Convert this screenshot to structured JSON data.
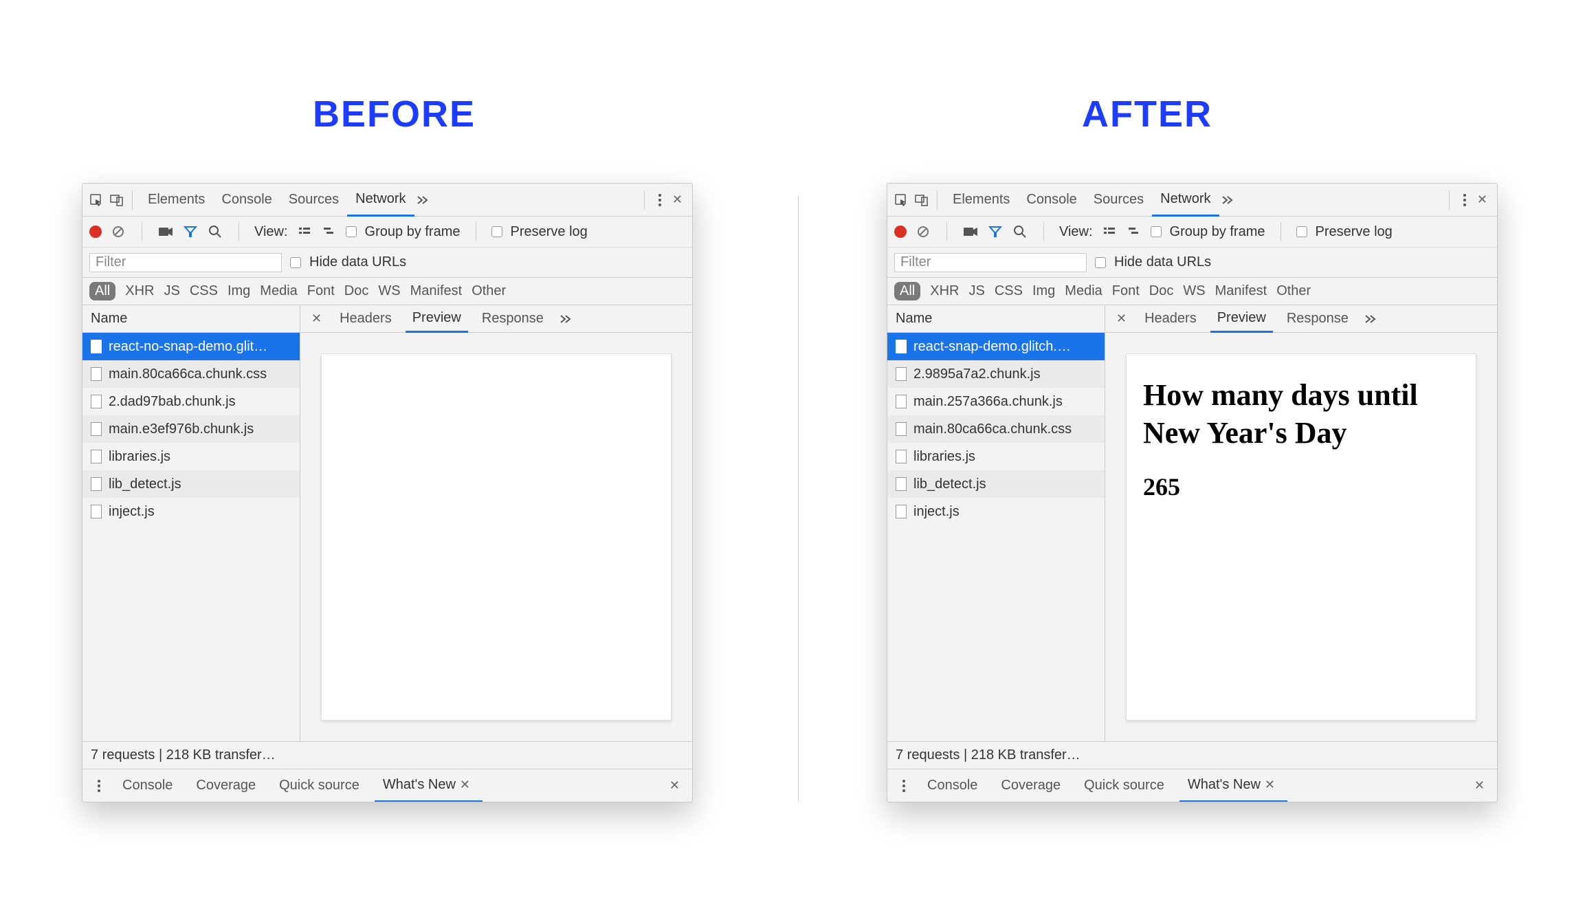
{
  "headings": {
    "before": "BEFORE",
    "after": "AFTER"
  },
  "devtools": {
    "top_tabs": [
      "Elements",
      "Console",
      "Sources",
      "Network"
    ],
    "active_top_tab": "Network",
    "view_label": "View:",
    "group_by_frame": "Group by frame",
    "preserve_log": "Preserve log",
    "filter_placeholder": "Filter",
    "hide_data_urls": "Hide data URLs",
    "type_filters": [
      "All",
      "XHR",
      "JS",
      "CSS",
      "Img",
      "Media",
      "Font",
      "Doc",
      "WS",
      "Manifest",
      "Other"
    ],
    "active_type_filter": "All",
    "name_header": "Name",
    "detail_tabs": [
      "Headers",
      "Preview",
      "Response"
    ],
    "active_detail_tab": "Preview",
    "status_text": "7 requests | 218 KB transfer…",
    "drawer_tabs": [
      "Console",
      "Coverage",
      "Quick source",
      "What's New"
    ],
    "active_drawer_tab": "What's New"
  },
  "before": {
    "requests": [
      "react-no-snap-demo.glit…",
      "main.80ca66ca.chunk.css",
      "2.dad97bab.chunk.js",
      "main.e3ef976b.chunk.js",
      "libraries.js",
      "lib_detect.js",
      "inject.js"
    ],
    "selected_index": 0,
    "preview_heading": "",
    "preview_value": ""
  },
  "after": {
    "requests": [
      "react-snap-demo.glitch.…",
      "2.9895a7a2.chunk.js",
      "main.257a366a.chunk.js",
      "main.80ca66ca.chunk.css",
      "libraries.js",
      "lib_detect.js",
      "inject.js"
    ],
    "selected_index": 0,
    "preview_heading": "How many days until New Year's Day",
    "preview_value": "265"
  }
}
